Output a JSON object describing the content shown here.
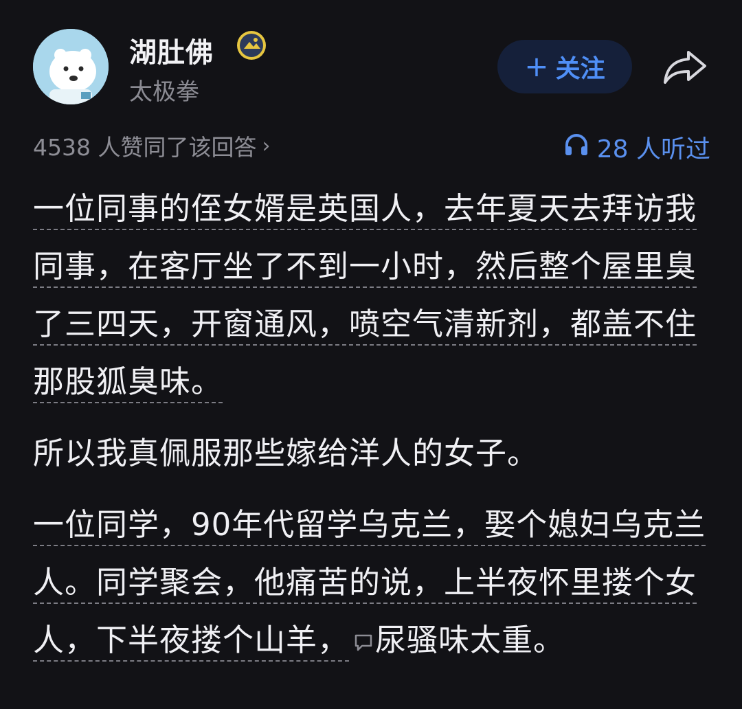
{
  "author": {
    "name": "湖肚佛",
    "subtitle": "太极拳"
  },
  "actions": {
    "follow_label": "关注"
  },
  "stats": {
    "approvals": "4538 人赞同了该回答",
    "listens": "28 人听过"
  },
  "content": {
    "paragraphs": [
      {
        "text": "一位同事的侄女婿是英国人，去年夏天去拜访我同事，在客厅坐了不到一小时，然后整个屋里臭了三四天，开窗通风，喷空气清新剂，都盖不住那股狐臭味。",
        "underlined": true
      },
      {
        "text": "所以我真佩服那些嫁给洋人的女子。",
        "underlined": false
      }
    ],
    "last_paragraph": {
      "underlined_text": "一位同学，90年代留学乌克兰，娶个媳妇乌克兰人。同学聚会，他痛苦的说，上半夜怀里搂个女人，下半夜搂个山羊，",
      "tail_text": "尿骚味太重。"
    }
  },
  "colors": {
    "background": "#121216",
    "accent": "#4f8ff7",
    "muted": "#8b8b93",
    "text": "#f0f0f4"
  },
  "icons": {
    "avatar": "polar-bear-avatar",
    "badge": "medal-badge-icon",
    "follow": "plus-icon",
    "share": "share-arrow-icon",
    "approvals": "chevron-right-icon",
    "listens": "headphones-icon",
    "comment": "comment-bubble-icon"
  }
}
